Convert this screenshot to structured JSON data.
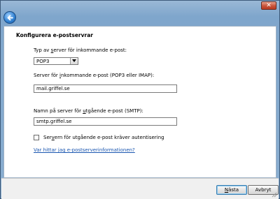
{
  "window": {
    "close_glyph": "✕"
  },
  "nav": {
    "back_icon": "back-arrow-icon"
  },
  "page": {
    "heading": "Konfigurera e-postservrar",
    "incoming_type": {
      "label_pre": "Typ av ",
      "label_accel": "s",
      "label_post": "erver för inkommande e-post:",
      "selected": "POP3"
    },
    "incoming_server": {
      "label_pre": "Server för ",
      "label_accel": "i",
      "label_post": "nkommande e-post (POP3 eller IMAP):",
      "value": "mail.griffel.se"
    },
    "outgoing_server": {
      "label_pre": "Namn på server för ",
      "label_accel": "u",
      "label_post": "tgående e-post (SMTP):",
      "value": "smtp.griffel.se"
    },
    "auth_checkbox": {
      "label_pre": "Ser",
      "label_accel": "v",
      "label_post": "ern för utgående e-post kräver autentisering",
      "checked": false
    },
    "help_link": "Var hittar jag e-postserverinformationen?"
  },
  "footer": {
    "next_pre": "",
    "next_accel": "N",
    "next_post": "ästa",
    "cancel": "Avbryt"
  }
}
